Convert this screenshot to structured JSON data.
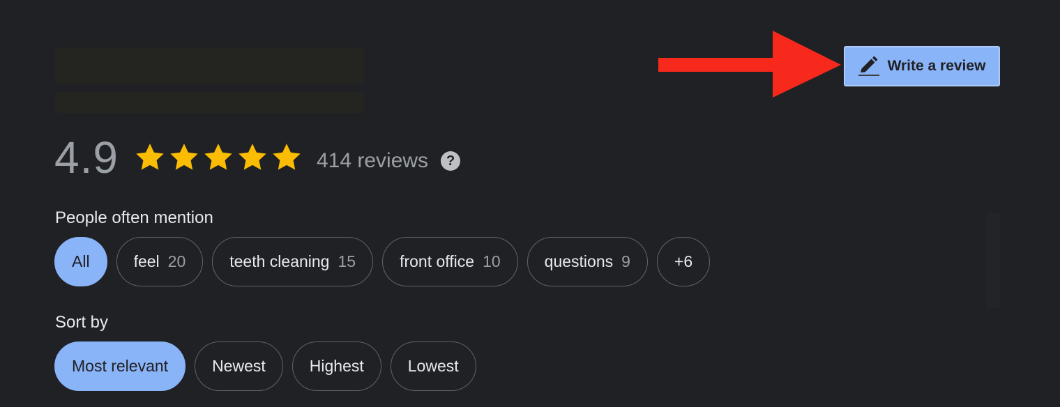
{
  "header": {
    "write_review_label": "Write a review"
  },
  "rating": {
    "value": "4.9",
    "stars": 5,
    "review_count": "414 reviews",
    "help_symbol": "?"
  },
  "mentions": {
    "label": "People often mention",
    "chips": [
      {
        "label": "All",
        "count": "",
        "selected": true
      },
      {
        "label": "feel",
        "count": "20",
        "selected": false
      },
      {
        "label": "teeth cleaning",
        "count": "15",
        "selected": false
      },
      {
        "label": "front office",
        "count": "10",
        "selected": false
      },
      {
        "label": "questions",
        "count": "9",
        "selected": false
      },
      {
        "label": "+6",
        "count": "",
        "selected": false
      }
    ]
  },
  "sort": {
    "label": "Sort by",
    "options": [
      {
        "label": "Most relevant",
        "selected": true
      },
      {
        "label": "Newest",
        "selected": false
      },
      {
        "label": "Highest",
        "selected": false
      },
      {
        "label": "Lowest",
        "selected": false
      }
    ]
  },
  "colors": {
    "background": "#202124",
    "accent": "#8ab4f8",
    "star": "#fbbc04",
    "annotation_arrow": "#f6291c"
  },
  "icons": {
    "write_review": "pencil-icon",
    "star": "star-icon",
    "help": "help-circle-icon",
    "annotation": "red-arrow-icon"
  }
}
